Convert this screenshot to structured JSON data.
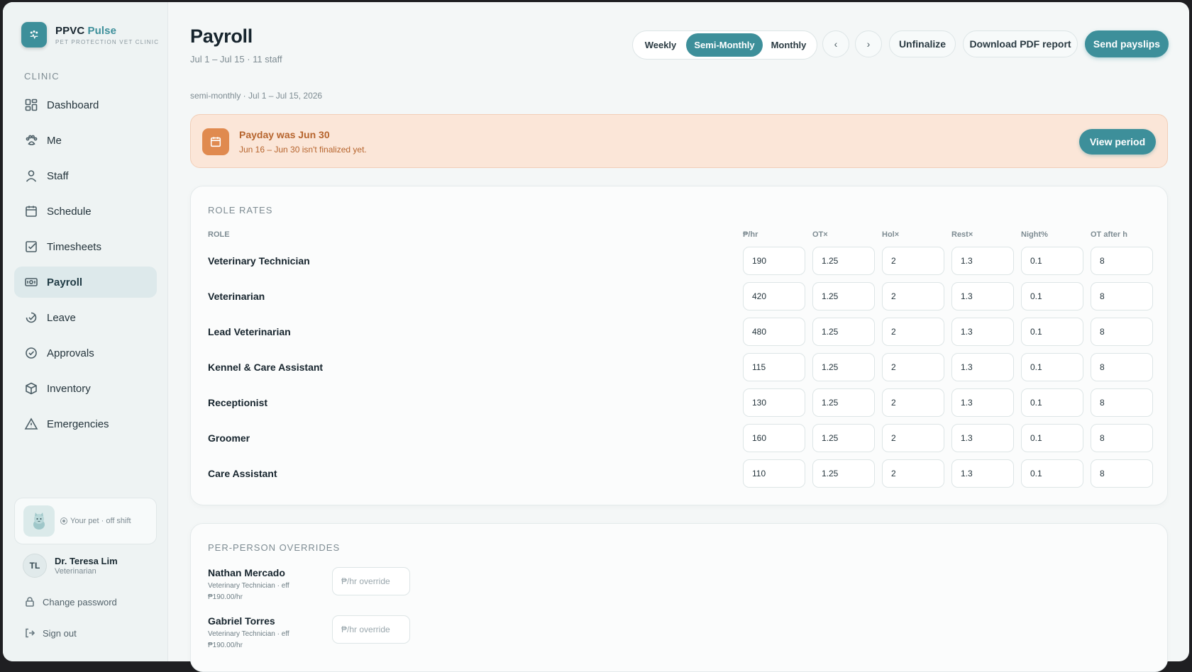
{
  "brand": {
    "name": "PPVC",
    "accent": "Pulse",
    "subtitle": "PET PROTECTION VET CLINIC"
  },
  "sidebar": {
    "section": "CLINIC",
    "items": [
      {
        "label": "Dashboard",
        "icon": "grid-icon"
      },
      {
        "label": "Me",
        "icon": "paw-icon"
      },
      {
        "label": "Staff",
        "icon": "person-icon"
      },
      {
        "label": "Schedule",
        "icon": "calendar-icon"
      },
      {
        "label": "Timesheets",
        "icon": "checkbox-icon"
      },
      {
        "label": "Payroll",
        "icon": "money-icon",
        "active": true
      },
      {
        "label": "Leave",
        "icon": "leave-icon"
      },
      {
        "label": "Approvals",
        "icon": "check-circle-icon"
      },
      {
        "label": "Inventory",
        "icon": "box-icon"
      },
      {
        "label": "Emergencies",
        "icon": "warning-icon"
      }
    ],
    "pet_status": "Your pet · off shift",
    "user": {
      "initials": "TL",
      "name": "Dr. Teresa Lim",
      "role": "Veterinarian"
    },
    "change_password": "Change password",
    "sign_out": "Sign out"
  },
  "header": {
    "title": "Payroll",
    "subtitle": "Jul 1 – Jul 15 · 11 staff",
    "period_label": "semi-monthly · Jul 1 – Jul 15, 2026",
    "segments": [
      "Weekly",
      "Semi-Monthly",
      "Monthly"
    ],
    "active_segment": "Semi-Monthly",
    "prev": "‹",
    "next": "›",
    "unfinalize": "Unfinalize",
    "download": "Download PDF report",
    "send": "Send payslips"
  },
  "alert": {
    "title": "Payday was Jun 30",
    "text": "Jun 16 – Jun 30 isn't finalized yet.",
    "button": "View period"
  },
  "rates": {
    "title": "ROLE RATES",
    "columns": [
      "ROLE",
      "₱/hr",
      "OT×",
      "Hol×",
      "Rest×",
      "Night%",
      "OT after h"
    ],
    "rows": [
      {
        "role": "Veterinary Technician",
        "values": [
          "190",
          "1.25",
          "2",
          "1.3",
          "0.1",
          "8"
        ]
      },
      {
        "role": "Veterinarian",
        "values": [
          "420",
          "1.25",
          "2",
          "1.3",
          "0.1",
          "8"
        ]
      },
      {
        "role": "Lead Veterinarian",
        "values": [
          "480",
          "1.25",
          "2",
          "1.3",
          "0.1",
          "8"
        ]
      },
      {
        "role": "Kennel & Care Assistant",
        "values": [
          "115",
          "1.25",
          "2",
          "1.3",
          "0.1",
          "8"
        ]
      },
      {
        "role": "Receptionist",
        "values": [
          "130",
          "1.25",
          "2",
          "1.3",
          "0.1",
          "8"
        ]
      },
      {
        "role": "Groomer",
        "values": [
          "160",
          "1.25",
          "2",
          "1.3",
          "0.1",
          "8"
        ]
      },
      {
        "role": "Care Assistant",
        "values": [
          "110",
          "1.25",
          "2",
          "1.3",
          "0.1",
          "8"
        ]
      }
    ]
  },
  "overrides": {
    "title": "PER-PERSON OVERRIDES",
    "placeholder": "₱/hr override",
    "people": [
      {
        "name": "Nathan Mercado",
        "meta": "Veterinary Technician · eff",
        "rate": "₱190.00/hr"
      },
      {
        "name": "Gabriel Torres",
        "meta": "Veterinary Technician · eff",
        "rate": "₱190.00/hr"
      }
    ]
  },
  "colors": {
    "accent": "#3d8f9a",
    "alert_bg": "#fbe6d8",
    "alert_text": "#b6642d"
  }
}
